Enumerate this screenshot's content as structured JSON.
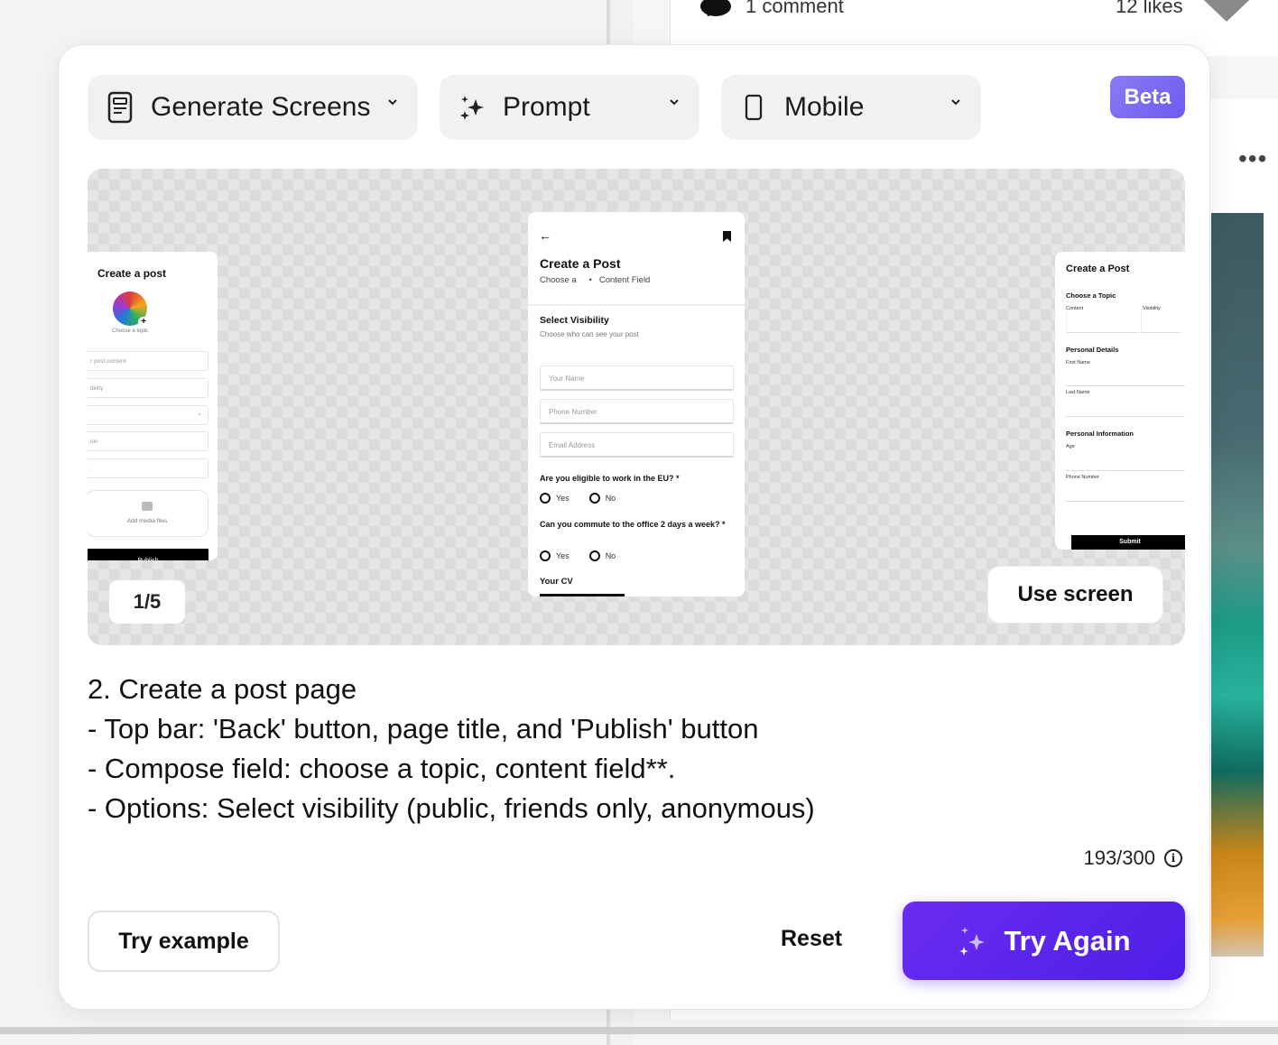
{
  "background": {
    "comment_count": "1 comment",
    "like_count": "12 likes"
  },
  "toolbar": {
    "mode_label": "Generate Screens",
    "input_label": "Prompt",
    "device_label": "Mobile",
    "beta_badge": "Beta"
  },
  "preview": {
    "counter": "1/5",
    "use_screen_label": "Use screen",
    "left_screen": {
      "title": "Create a post",
      "choose_topic": "Choose a topic",
      "fields": [
        "r post content",
        "ibility",
        "",
        "ion",
        ":"
      ],
      "add_media": "Add media files",
      "button": "Publish"
    },
    "center_screen": {
      "title": "Create a Post",
      "sub_left": "Choose a",
      "sub_right": "Content Field",
      "section_title": "Select Visibility",
      "section_sub": "Choose who can see your post",
      "inputs": [
        "Your Name",
        "Phone Number",
        "Email Address"
      ],
      "q1": "Are you eligible to work in the EU? *",
      "q2": "Can you commute to the office 2 days a week? *",
      "yes": "Yes",
      "no": "No",
      "cv": "Your CV"
    },
    "right_screen": {
      "title": "Create a Post",
      "topic_heading": "Choose a Topic",
      "content_label": "Content",
      "visibility_label": "Visibility",
      "personal_details": "Personal Details",
      "first_name": "First Name",
      "last_name": "Last Name",
      "personal_info": "Personal Information",
      "age": "Age",
      "phone": "Phone Number",
      "submit": "Submit"
    }
  },
  "prompt": {
    "lines": [
      "2. Create a post page",
      "- Top bar: 'Back' button, page title, and 'Publish' button",
      "- Compose field: choose a topic, content field**.",
      "- Options: Select visibility (public, friends only, anonymous)"
    ],
    "char_count": "193/300"
  },
  "actions": {
    "try_example": "Try example",
    "reset": "Reset",
    "try_again": "Try Again"
  },
  "colors": {
    "accent": "#5b24ee",
    "beta": "#7b6af2"
  }
}
